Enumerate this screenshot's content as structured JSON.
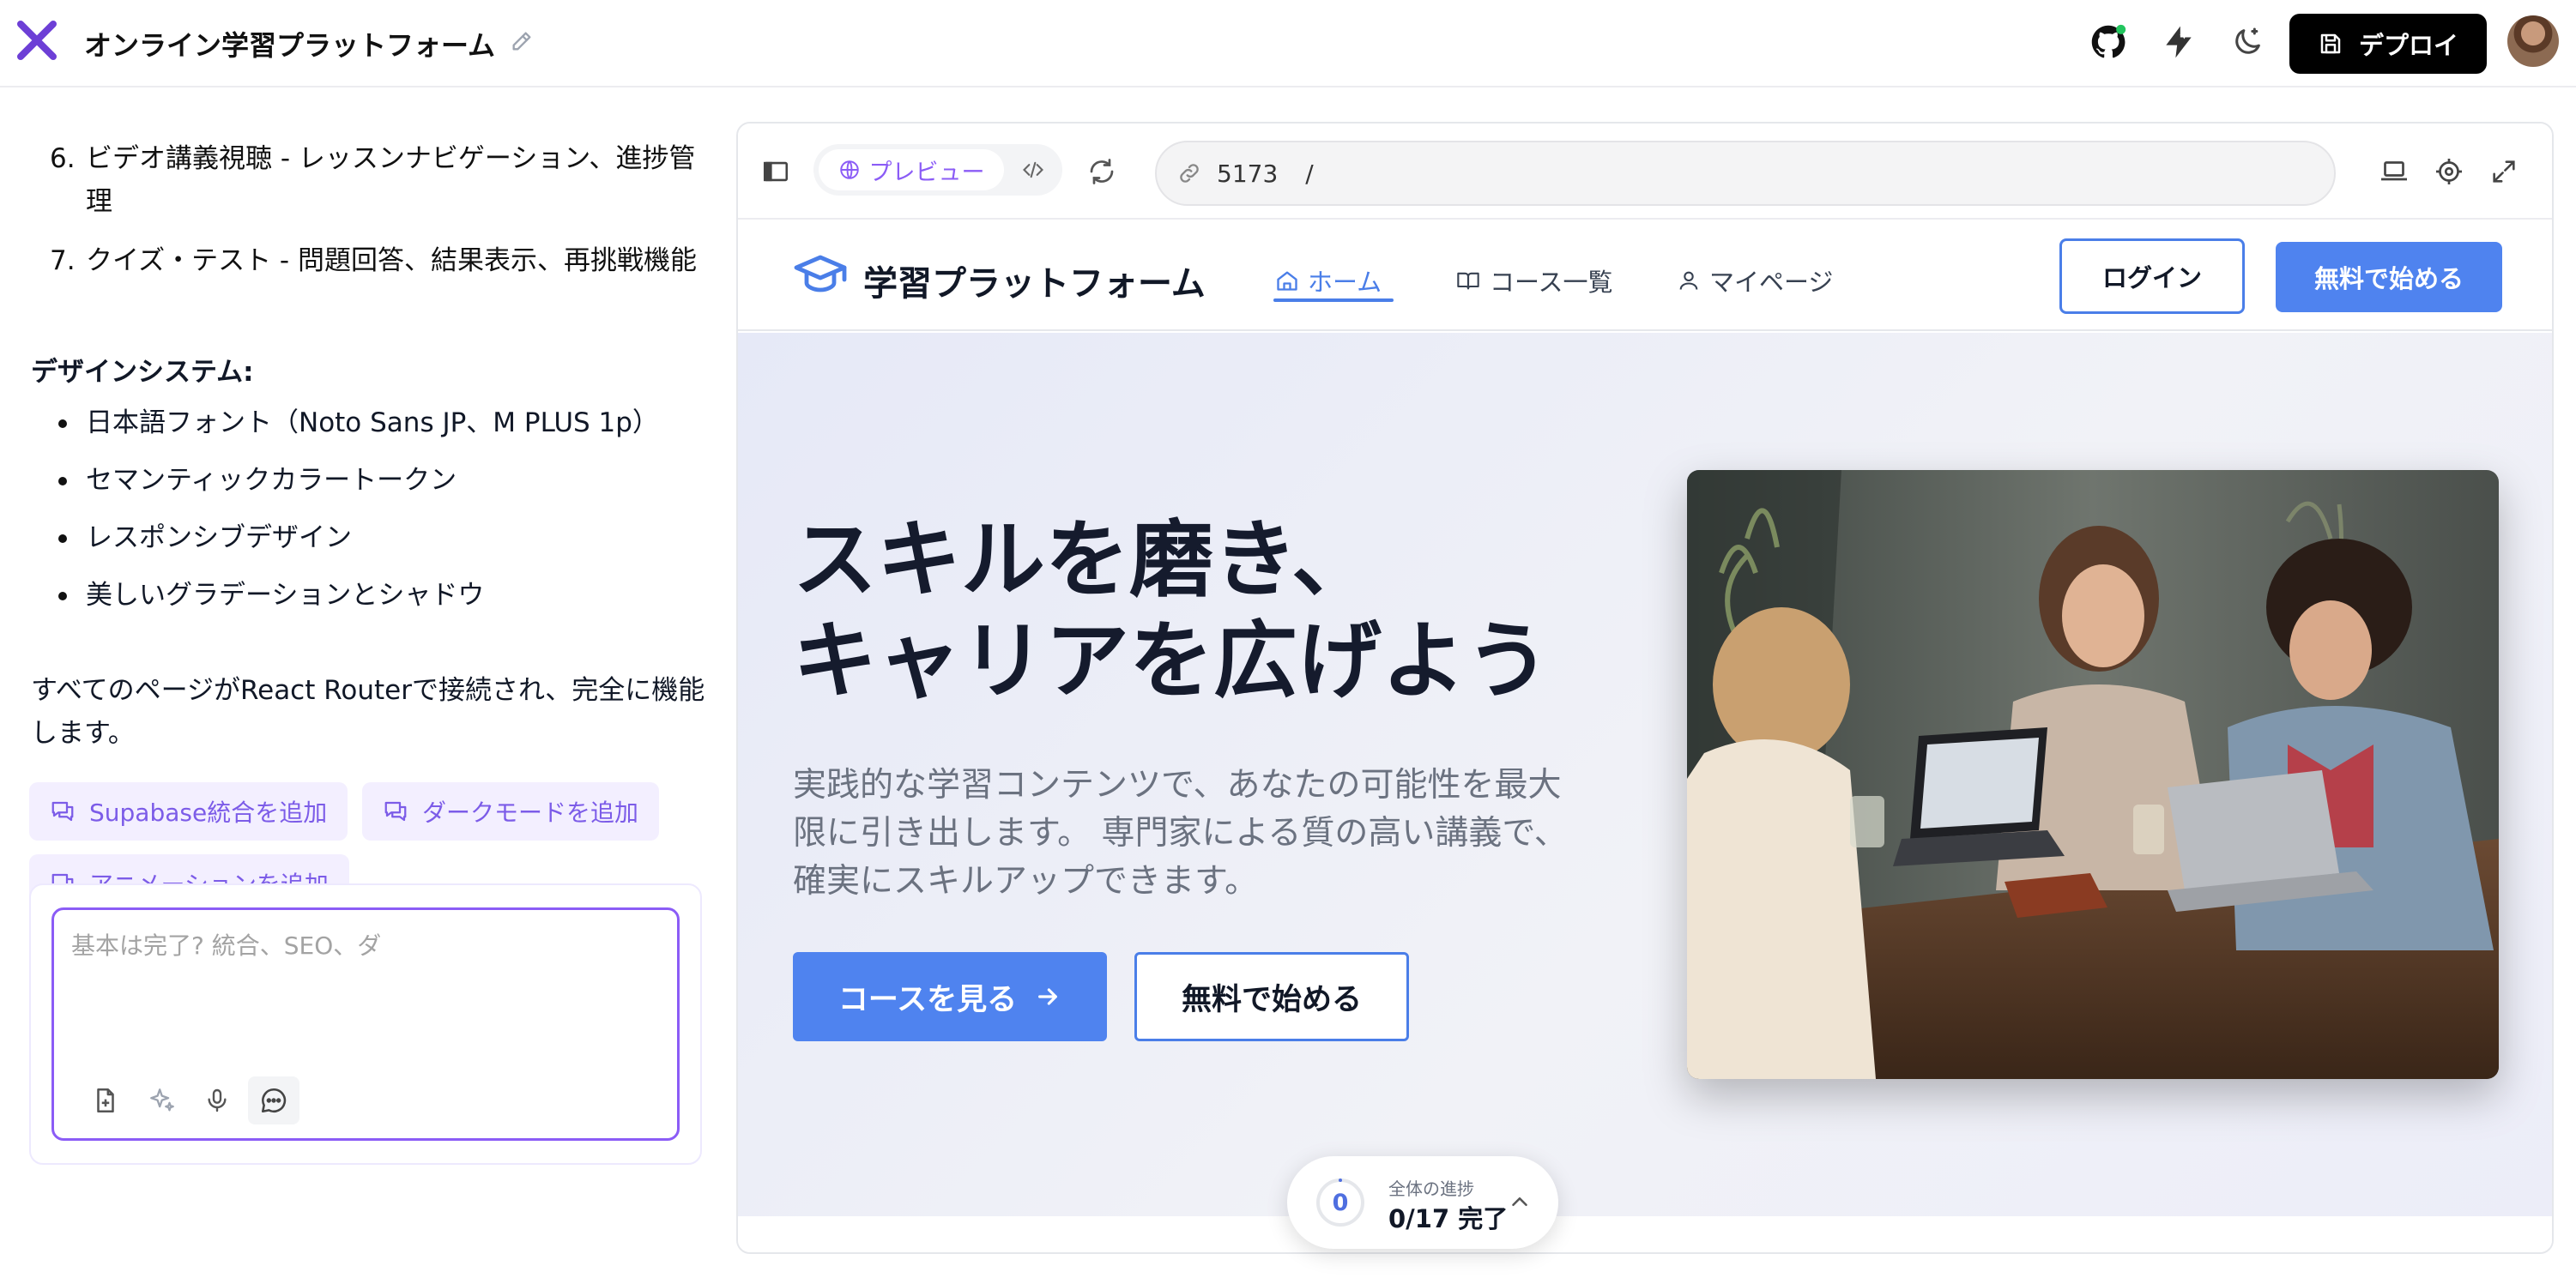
{
  "app": {
    "project_title": "オンライン学習プラットフォーム",
    "deploy_label": "デプロイ"
  },
  "chat": {
    "steps": [
      {
        "num": "6.",
        "text": "ビデオ講義視聴 - レッスンナビゲーション、進捗管理"
      },
      {
        "num": "7.",
        "text": "クイズ・テスト - 問題回答、結果表示、再挑戦機能"
      }
    ],
    "design_title": "デザインシステム:",
    "design_items": [
      "日本語フォント（Noto Sans JP、M PLUS 1p）",
      "セマンティックカラートークン",
      "レスポンシブデザイン",
      "美しいグラデーションとシャドウ"
    ],
    "summary": "すべてのページがReact Routerで接続され、完全に機能します。",
    "suggestions": [
      "Supabase統合を追加",
      "ダークモードを追加",
      "アニメーションを追加"
    ],
    "input_placeholder": "基本は完了? 統合、SEO、ダ",
    "input_value": ""
  },
  "preview": {
    "mode_label": "プレビュー",
    "url_port": "5173",
    "url_path": "/"
  },
  "site": {
    "brand": "学習プラットフォーム",
    "nav": [
      {
        "label": "ホーム",
        "icon": "home-icon",
        "active": true
      },
      {
        "label": "コース一覧",
        "icon": "book-icon",
        "active": false
      },
      {
        "label": "マイページ",
        "icon": "user-icon",
        "active": false
      }
    ],
    "login_label": "ログイン",
    "start_label": "無料で始める",
    "hero": {
      "title_line1": "スキルを磨き、",
      "title_line2": "キャリアを広げよう",
      "subtitle": "実践的な学習コンテンツで、あなたの可能性を最大限に引き出します。 専門家による質の高い講義で、確実にスキルアップできます。",
      "primary_cta": "コースを見る",
      "secondary_cta": "無料で始める"
    }
  },
  "progress": {
    "count": "0",
    "label": "全体の進捗",
    "value": "0/17 完了",
    "completed": 0,
    "total": 17
  },
  "colors": {
    "accent_purple": "#8b5cf6",
    "site_blue": "#4f83ef",
    "deploy_bg": "#000000"
  }
}
